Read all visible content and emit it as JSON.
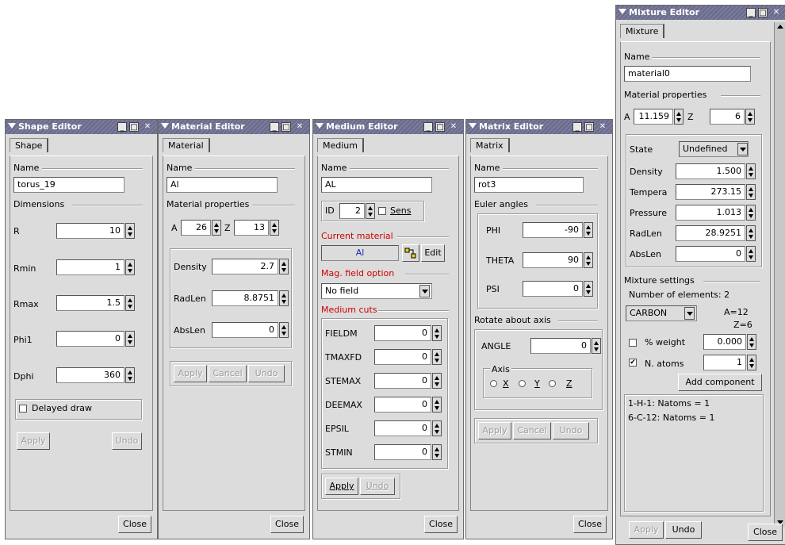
{
  "windows": {
    "shape": {
      "title": "Shape Editor",
      "tab": "Shape",
      "name_label": "Name",
      "name_value": "torus_19",
      "dimensions_label": "Dimensions",
      "rows": [
        {
          "label": "R",
          "value": "10"
        },
        {
          "label": "Rmin",
          "value": "1"
        },
        {
          "label": "Rmax",
          "value": "1.5"
        },
        {
          "label": "Phi1",
          "value": "0"
        },
        {
          "label": "Dphi",
          "value": "360"
        }
      ],
      "delayed_draw": "Delayed draw",
      "apply": "Apply",
      "undo": "Undo",
      "close": "Close"
    },
    "material": {
      "title": "Material Editor",
      "tab": "Material",
      "name_label": "Name",
      "name_value": "Al",
      "props_label": "Material properties",
      "a_label": "A",
      "a_value": "26",
      "z_label": "Z",
      "z_value": "13",
      "rows": [
        {
          "label": "Density",
          "value": "2.7"
        },
        {
          "label": "RadLen",
          "value": "8.8751"
        },
        {
          "label": "AbsLen",
          "value": "0"
        }
      ],
      "apply": "Apply",
      "cancel": "Cancel",
      "undo": "Undo",
      "close": "Close"
    },
    "medium": {
      "title": "Medium Editor",
      "tab": "Medium",
      "name_label": "Name",
      "name_value": "AL",
      "id_label": "ID",
      "id_value": "2",
      "sens_label": "Sens",
      "current_material_label": "Current material",
      "current_material": "Al",
      "edit": "Edit",
      "mag_label": "Mag. field option",
      "mag_value": "No field",
      "cuts_label": "Medium cuts",
      "cuts": [
        {
          "label": "FIELDM",
          "value": "0"
        },
        {
          "label": "TMAXFD",
          "value": "0"
        },
        {
          "label": "STEMAX",
          "value": "0"
        },
        {
          "label": "DEEMAX",
          "value": "0"
        },
        {
          "label": "EPSIL",
          "value": "0"
        },
        {
          "label": "STMIN",
          "value": "0"
        }
      ],
      "apply": "Apply",
      "undo": "Undo",
      "close": "Close"
    },
    "matrix": {
      "title": "Matrix Editor",
      "tab": "Matrix",
      "name_label": "Name",
      "name_value": "rot3",
      "euler_label": "Euler angles",
      "rows": [
        {
          "label": "PHI",
          "value": "-90"
        },
        {
          "label": "THETA",
          "value": "90"
        },
        {
          "label": "PSI",
          "value": "0"
        }
      ],
      "rotate_label": "Rotate about axis",
      "angle_label": "ANGLE",
      "angle_value": "0",
      "axis_label": "Axis",
      "axis_options": [
        "X",
        "Y",
        "Z"
      ],
      "apply": "Apply",
      "cancel": "Cancel",
      "undo": "Undo",
      "close": "Close"
    },
    "mixture": {
      "title": "Mixture Editor",
      "tab": "Mixture",
      "name_label": "Name",
      "name_value": "material0",
      "props_label": "Material properties",
      "a_label": "A",
      "a_value": "11.159",
      "z_label": "Z",
      "z_value": "6",
      "state_label": "State",
      "state_value": "Undefined",
      "rows": [
        {
          "label": "Density",
          "value": "1.500"
        },
        {
          "label": "Tempera",
          "value": "273.15"
        },
        {
          "label": "Pressure",
          "value": "1.013"
        },
        {
          "label": "RadLen",
          "value": "28.9251"
        },
        {
          "label": "AbsLen",
          "value": "0"
        }
      ],
      "settings_label": "Mixture settings",
      "num_elements": "Number of elements: 2",
      "element": "CARBON",
      "a_eq": "A=12",
      "z_eq": "Z=6",
      "weight_label": "% weight",
      "weight_value": "0.000",
      "natoms_label": "N. atoms",
      "natoms_value": "1",
      "add_component": "Add component",
      "components": [
        "1-H-1: Natoms = 1",
        "6-C-12: Natoms = 1"
      ],
      "apply": "Apply",
      "undo": "Undo",
      "close": "Close"
    }
  }
}
